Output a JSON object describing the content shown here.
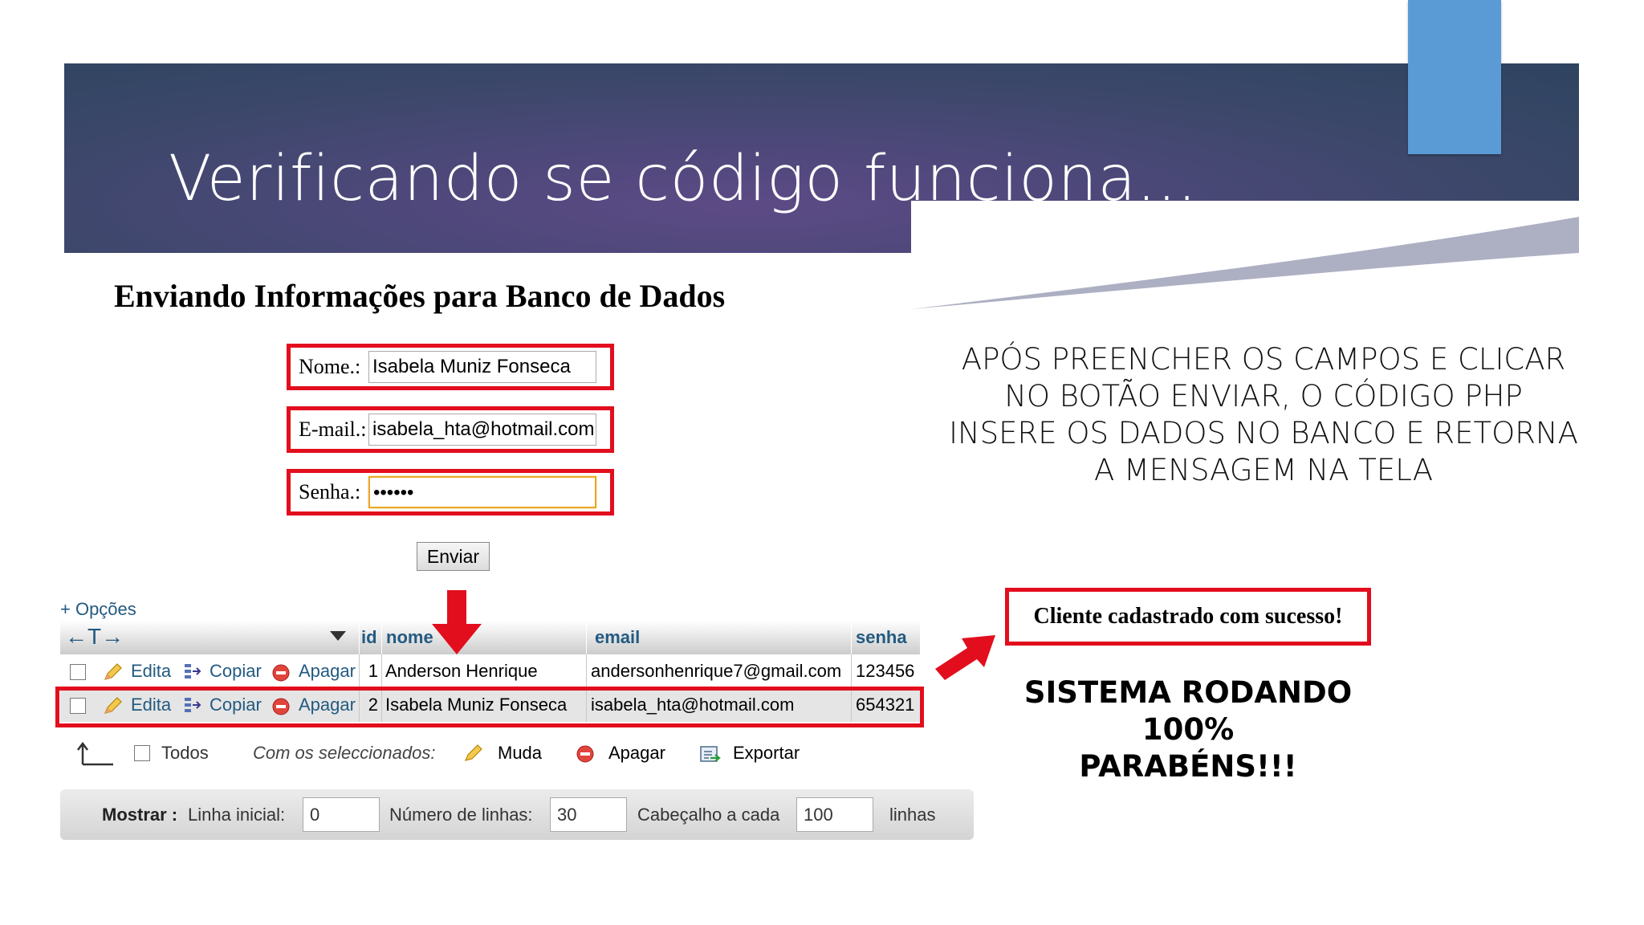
{
  "slide": {
    "title": "Verificando se código funciona...",
    "colors": {
      "banner": "#4b4878",
      "accent_rect": "#5b9bd5",
      "highlight_red": "#e20e1d"
    }
  },
  "form": {
    "heading": "Enviando Informações para Banco de Dados",
    "fields": [
      {
        "label": "Nome.:",
        "value": "Isabela Muniz Fonseca"
      },
      {
        "label": "E-mail.:",
        "value": "isabela_hta@hotmail.com"
      },
      {
        "label": "Senha.:",
        "value": "••••••"
      }
    ],
    "submit_label": "Enviar"
  },
  "instructions": {
    "lines": [
      "APÓS PREENCHER OS CAMPOS E CLICAR",
      "NO BOTÃO ENVIAR, O CÓDIGO PHP",
      "INSERE OS DADOS NO BANCO E RETORNA",
      "A MENSAGEM NA TELA"
    ]
  },
  "result": {
    "message": "Cliente cadastrado com sucesso!",
    "congrats_lines": [
      "SISTEMA RODANDO 100%",
      "PARABÉNS!!!"
    ]
  },
  "table": {
    "options_label": "+ Opções",
    "arrows_glyph": "←T→",
    "columns": [
      "id",
      "nome",
      "email",
      "senha"
    ],
    "actions": {
      "edit": "Edita",
      "copy": "Copiar",
      "delete": "Apagar"
    },
    "rows": [
      {
        "id": "1",
        "nome": "Anderson Henrique",
        "email": "andersonhenrique7@gmail.com",
        "senha": "123456"
      },
      {
        "id": "2",
        "nome": "Isabela Muniz Fonseca",
        "email": "isabela_hta@hotmail.com",
        "senha": "654321"
      }
    ]
  },
  "bulk_actions": {
    "check_all": "Todos",
    "with_selected": "Com os seleccionados:",
    "change": "Muda",
    "delete": "Apagar",
    "export": "Exportar"
  },
  "pagination": {
    "show_label": "Mostrar :",
    "start_row_label": "Linha inicial:",
    "start_row_value": "0",
    "num_rows_label": "Número de linhas:",
    "num_rows_value": "30",
    "header_every_label": "Cabeçalho a cada",
    "header_every_value": "100",
    "rows_suffix": "linhas"
  },
  "icons": [
    "pencil-icon",
    "copy-icon",
    "delete-icon",
    "export-icon",
    "arrow-up-left-icon",
    "sort-triangle-icon"
  ]
}
